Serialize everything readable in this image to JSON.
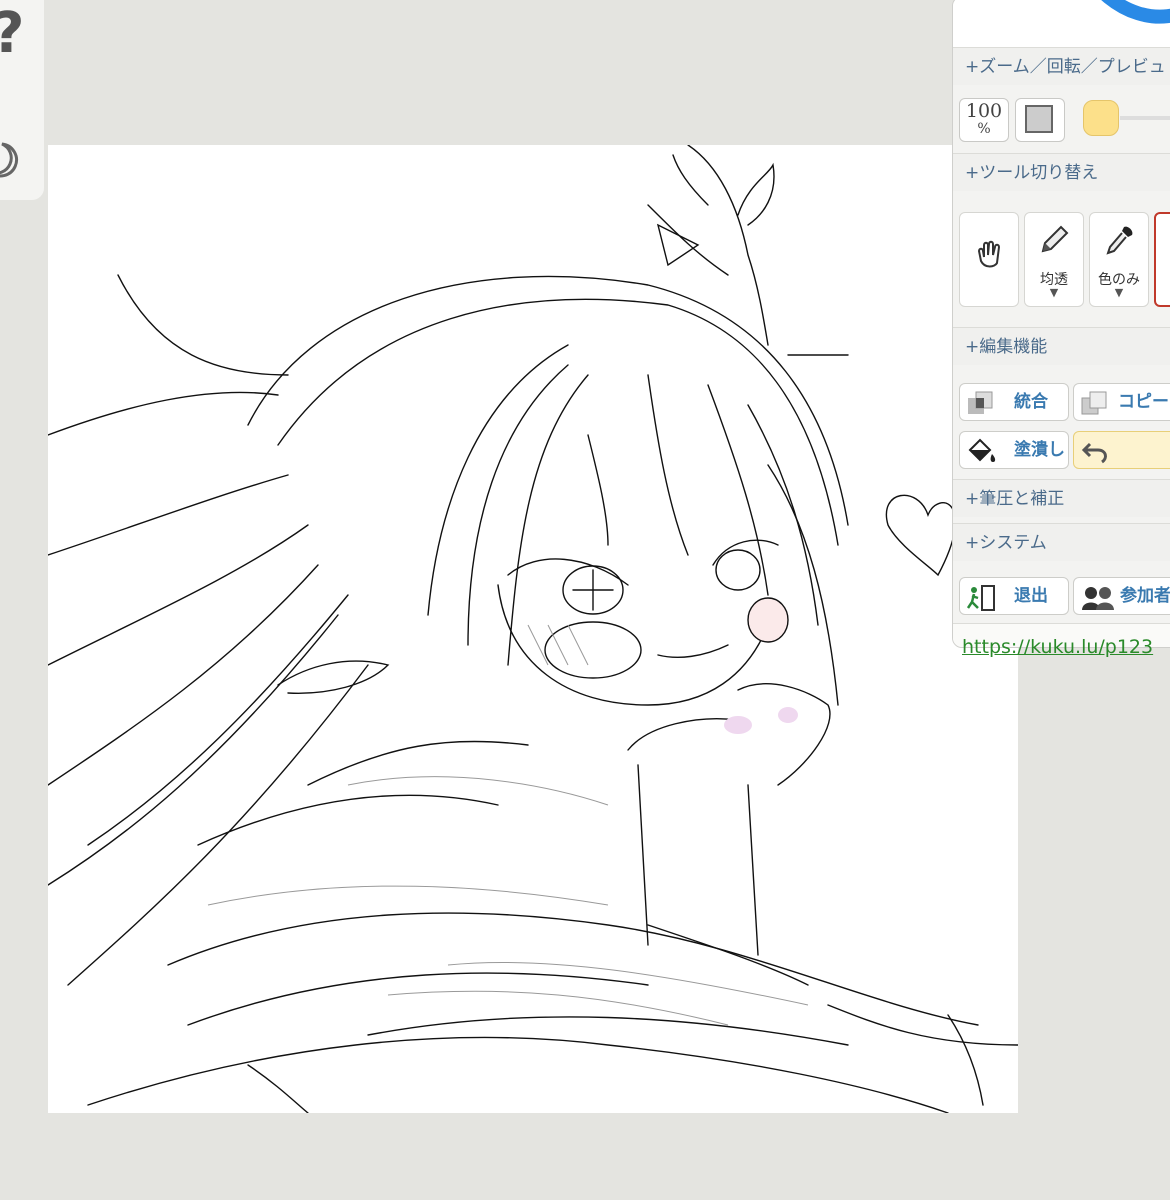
{
  "left_strip": {
    "help_icon": "question-icon",
    "moon_icon": "moon-icon"
  },
  "canvas": {
    "description_icon": "drawing-canvas"
  },
  "panel": {
    "sections": {
      "zoom": "+ズーム／回転／プレビュ",
      "tools": "+ツール切り替え",
      "edit": "+編集機能",
      "pressure": "+筆圧と補正",
      "system": "+システム"
    },
    "zoom": {
      "value": "100",
      "unit": "%"
    },
    "tools": [
      {
        "name": "hand",
        "label": "",
        "arrow": ""
      },
      {
        "name": "pencil",
        "label": "均透",
        "arrow": "▼"
      },
      {
        "name": "eyedropper",
        "label": "色のみ",
        "arrow": "▼"
      }
    ],
    "edit_buttons": {
      "merge": "統合",
      "copy": "コピー",
      "fill": "塗潰し"
    },
    "system_buttons": {
      "exit": "退出",
      "participants": "参加者"
    },
    "url": "https://kuku.lu/p123"
  },
  "colors": {
    "current_color": "#fce08a",
    "panel_text": "#4a6a8a",
    "button_text": "#3a7ab0",
    "link": "#2a8a2a"
  }
}
